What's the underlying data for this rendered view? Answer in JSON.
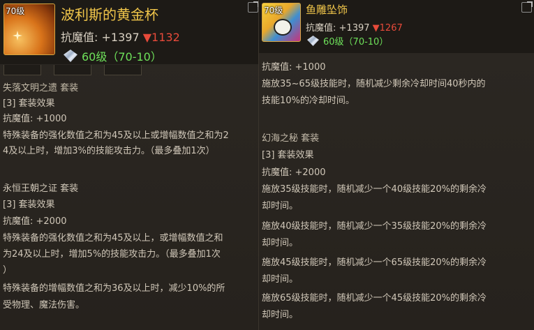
{
  "left": {
    "level": "70级",
    "name": "波利斯的黄金杯",
    "stat_label": "抗魔值:",
    "stat_value": "+1397",
    "stat_change": "▼1132",
    "badge": "60级（70-10）",
    "lines": [
      "失落文明之遗 套装",
      "[3] 套装效果",
      "抗魔值: +1000",
      "特殊装备的强化数值之和为45及以上或增幅数值之和为2",
      "4及以上时，增加3%的技能攻击力。（最多叠加1次）",
      "",
      "永恒王朝之证 套装",
      "[3] 套装效果",
      "抗魔值: +2000",
      "特殊装备的强化数值之和为45及以上，或增幅数值之和",
      "为24及以上时，增加5%的技能攻击力。（最多叠加1次",
      "）",
      "特殊装备的增幅数值之和为36及以上时，减少10%的所",
      "受物理、魔法伤害。"
    ]
  },
  "right": {
    "level": "70级",
    "name": "鱼雕坠饰",
    "stat_label": "抗魔值:",
    "stat_value": "+1397",
    "stat_change": "▼1267",
    "badge": "60级（70-10）",
    "lines": [
      "抗魔值: +1000",
      "施放35~65级技能时，随机减少剩余冷却时间40秒内的",
      "技能10%的冷却时间。",
      "",
      "幻海之秘 套装",
      "[3] 套装效果",
      "抗魔值: +2000",
      "施放35级技能时，随机减少一个40级技能20%的剩余冷",
      "却时间。",
      "施放40级技能时，随机减少一个35级技能20%的剩余冷",
      "却时间。",
      "施放45级技能时，随机减少一个65级技能20%的剩余冷",
      "却时间。",
      "施放65级技能时，随机减少一个45级技能20%的剩余冷",
      "却时间。"
    ]
  },
  "colors": {
    "item_name": "#f0c54a",
    "stat_decrease": "#e74a3a",
    "level_requirement": "#6ee05a",
    "body_text": "#d0c7b8"
  }
}
